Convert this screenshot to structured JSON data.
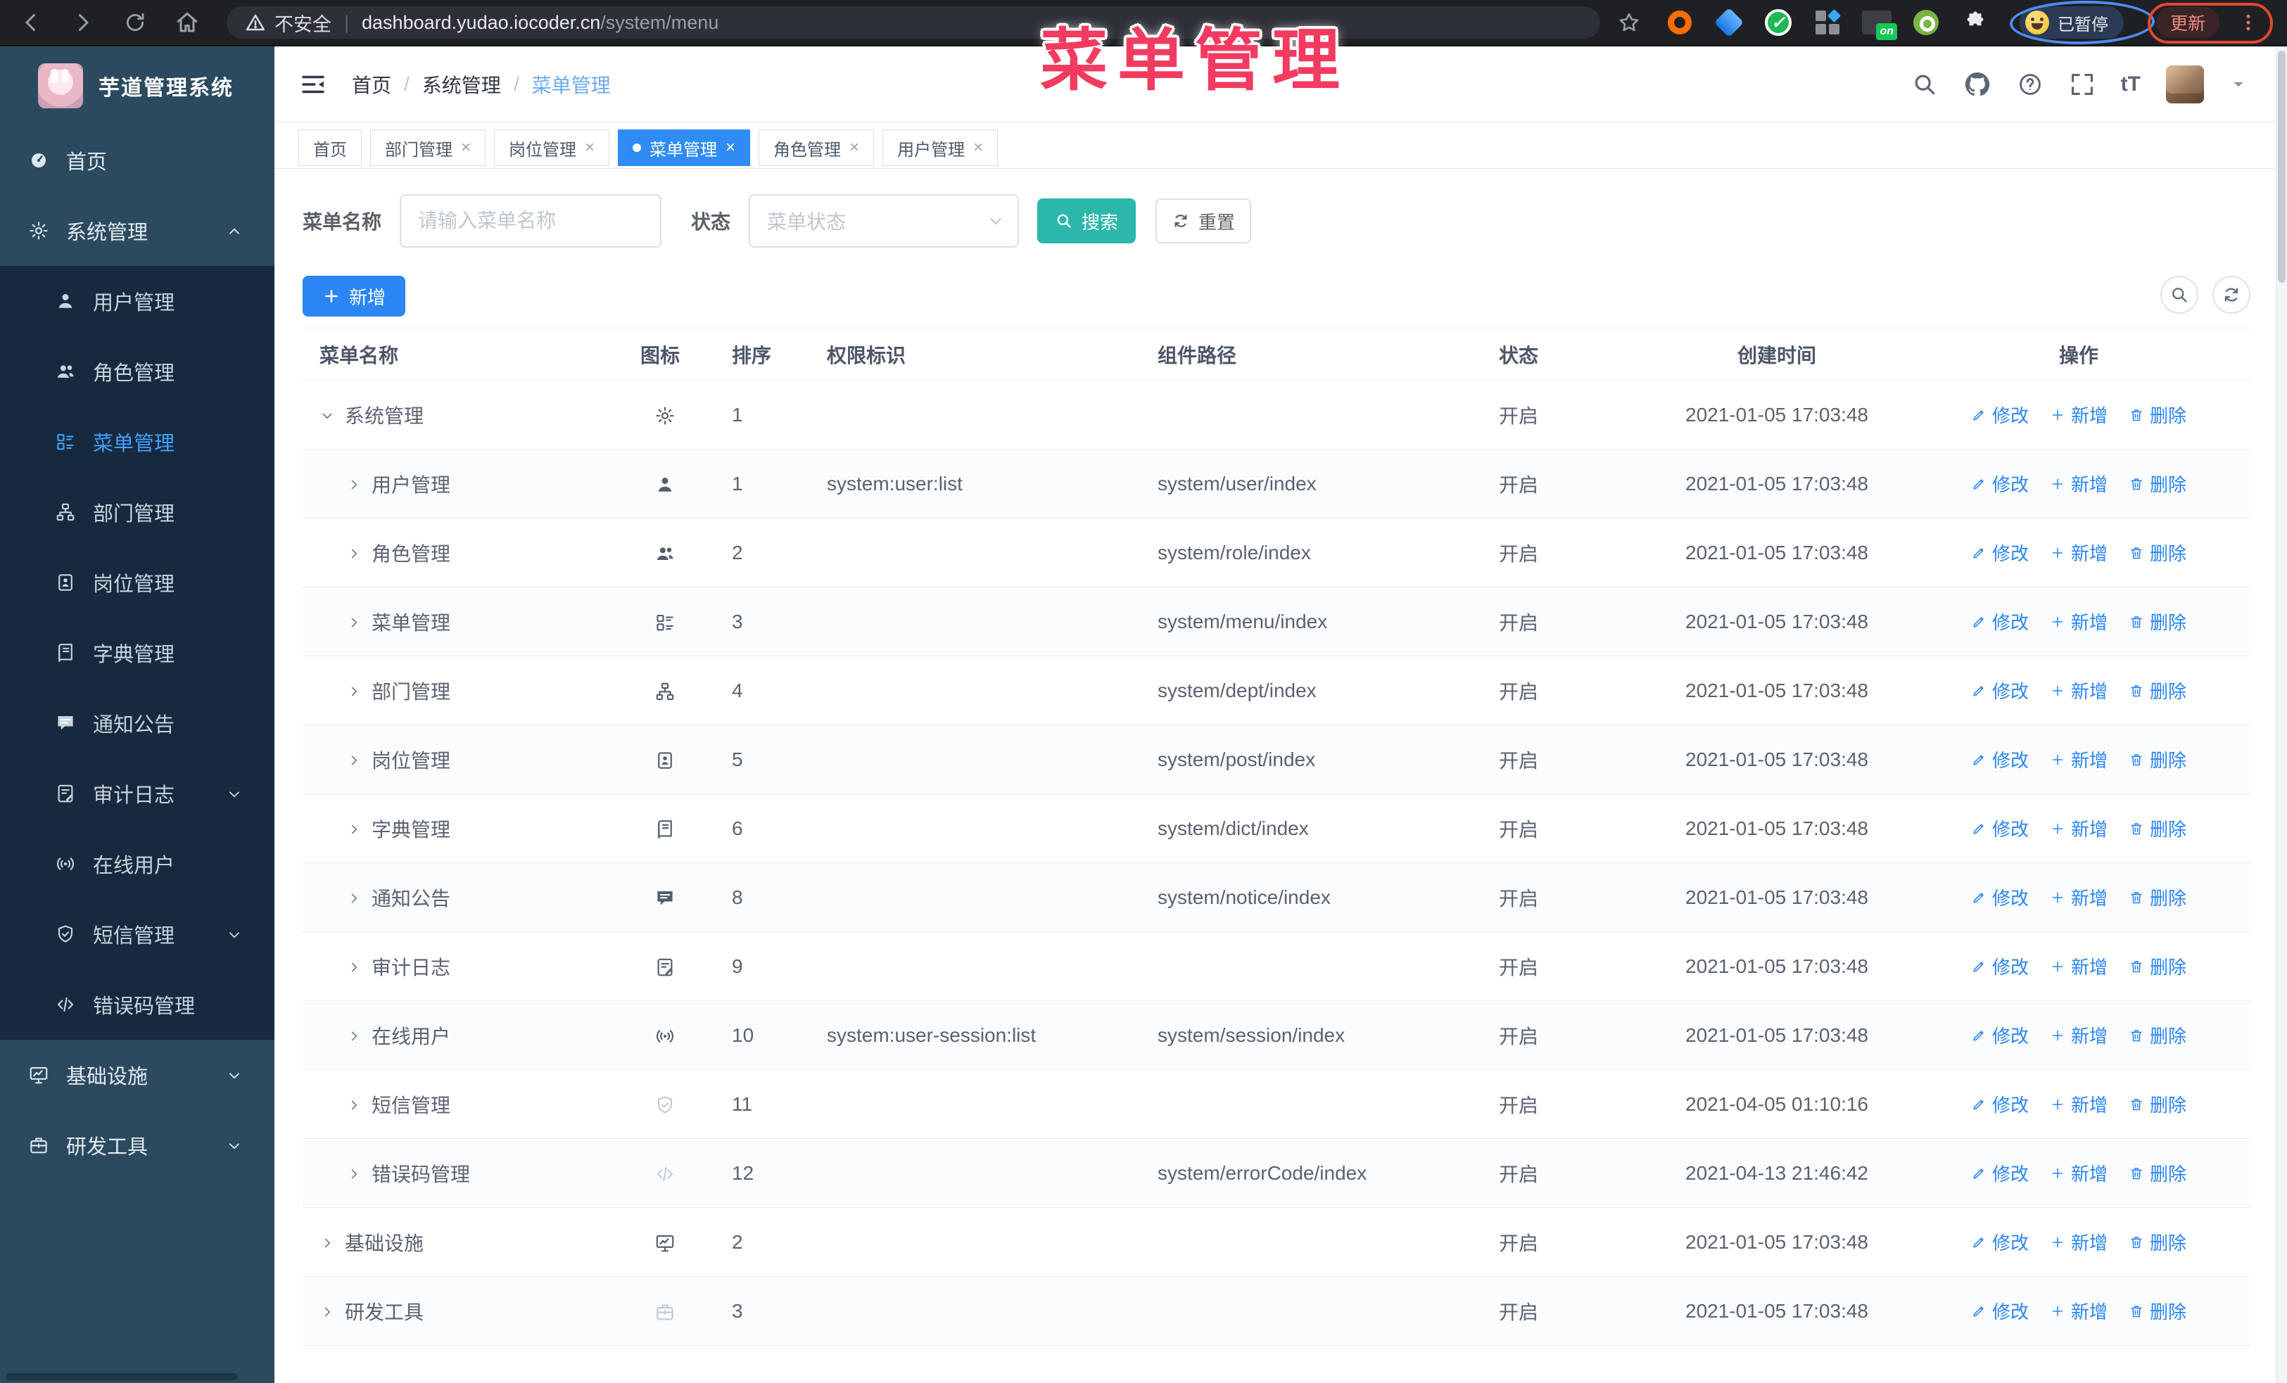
{
  "browser": {
    "security_label": "不安全",
    "url_host": "dashboard.yudao.iocoder.cn",
    "url_path": "/system/menu",
    "paused_badge": "已暂停",
    "update_button": "更新",
    "ext_on_label": "on"
  },
  "annotation": {
    "title": "菜单管理",
    "pink": "#f23b60",
    "blue_ring": "#4f8cf5",
    "red_ring": "#e2472e"
  },
  "sidebar": {
    "app_title": "芋道管理系统",
    "items": [
      {
        "icon": "gauge",
        "label": "首页",
        "type": "root"
      },
      {
        "icon": "gear",
        "label": "系统管理",
        "type": "root",
        "caret": "up",
        "open": true
      },
      {
        "icon": "user",
        "label": "用户管理",
        "type": "sub"
      },
      {
        "icon": "users",
        "label": "角色管理",
        "type": "sub"
      },
      {
        "icon": "menu-tree",
        "label": "菜单管理",
        "type": "sub",
        "active": true
      },
      {
        "icon": "org",
        "label": "部门管理",
        "type": "sub"
      },
      {
        "icon": "badge",
        "label": "岗位管理",
        "type": "sub"
      },
      {
        "icon": "book",
        "label": "字典管理",
        "type": "sub"
      },
      {
        "icon": "notice",
        "label": "通知公告",
        "type": "sub"
      },
      {
        "icon": "log",
        "label": "审计日志",
        "type": "sub",
        "caret": "down"
      },
      {
        "icon": "online",
        "label": "在线用户",
        "type": "sub"
      },
      {
        "icon": "shield",
        "label": "短信管理",
        "type": "sub",
        "caret": "down"
      },
      {
        "icon": "code",
        "label": "错误码管理",
        "type": "sub"
      },
      {
        "icon": "monitor",
        "label": "基础设施",
        "type": "root",
        "caret": "down"
      },
      {
        "icon": "tool",
        "label": "研发工具",
        "type": "root",
        "caret": "down"
      }
    ]
  },
  "navbar": {
    "breadcrumb": [
      "首页",
      "系统管理",
      "菜单管理"
    ]
  },
  "tabs": [
    {
      "label": "首页",
      "closable": false,
      "active": false
    },
    {
      "label": "部门管理",
      "closable": true,
      "active": false
    },
    {
      "label": "岗位管理",
      "closable": true,
      "active": false
    },
    {
      "label": "菜单管理",
      "closable": true,
      "active": true
    },
    {
      "label": "角色管理",
      "closable": true,
      "active": false
    },
    {
      "label": "用户管理",
      "closable": true,
      "active": false
    }
  ],
  "filters": {
    "name_label": "菜单名称",
    "name_placeholder": "请输入菜单名称",
    "status_label": "状态",
    "status_placeholder": "菜单状态",
    "search_label": "搜索",
    "reset_label": "重置"
  },
  "toolbar": {
    "add_label": "新增"
  },
  "table": {
    "columns": [
      "菜单名称",
      "图标",
      "排序",
      "权限标识",
      "组件路径",
      "状态",
      "创建时间",
      "操作"
    ],
    "row_actions": [
      {
        "label": "修改",
        "icon": "edit"
      },
      {
        "label": "新增",
        "icon": "plus"
      },
      {
        "label": "删除",
        "icon": "trash"
      }
    ],
    "rows": [
      {
        "level": 0,
        "expanded": true,
        "name": "系统管理",
        "icon": "gear",
        "sort": "1",
        "perm": "",
        "path": "",
        "status": "开启",
        "time": "2021-01-05 17:03:48"
      },
      {
        "level": 1,
        "expanded": false,
        "name": "用户管理",
        "icon": "user",
        "sort": "1",
        "perm": "system:user:list",
        "path": "system/user/index",
        "status": "开启",
        "time": "2021-01-05 17:03:48"
      },
      {
        "level": 1,
        "expanded": false,
        "name": "角色管理",
        "icon": "users",
        "sort": "2",
        "perm": "",
        "path": "system/role/index",
        "status": "开启",
        "time": "2021-01-05 17:03:48"
      },
      {
        "level": 1,
        "expanded": false,
        "name": "菜单管理",
        "icon": "menu-tree",
        "sort": "3",
        "perm": "",
        "path": "system/menu/index",
        "status": "开启",
        "time": "2021-01-05 17:03:48"
      },
      {
        "level": 1,
        "expanded": false,
        "name": "部门管理",
        "icon": "org",
        "sort": "4",
        "perm": "",
        "path": "system/dept/index",
        "status": "开启",
        "time": "2021-01-05 17:03:48"
      },
      {
        "level": 1,
        "expanded": false,
        "name": "岗位管理",
        "icon": "badge",
        "sort": "5",
        "perm": "",
        "path": "system/post/index",
        "status": "开启",
        "time": "2021-01-05 17:03:48"
      },
      {
        "level": 1,
        "expanded": false,
        "name": "字典管理",
        "icon": "book",
        "sort": "6",
        "perm": "",
        "path": "system/dict/index",
        "status": "开启",
        "time": "2021-01-05 17:03:48"
      },
      {
        "level": 1,
        "expanded": false,
        "name": "通知公告",
        "icon": "notice",
        "sort": "8",
        "perm": "",
        "path": "system/notice/index",
        "status": "开启",
        "time": "2021-01-05 17:03:48"
      },
      {
        "level": 1,
        "expanded": false,
        "name": "审计日志",
        "icon": "log",
        "sort": "9",
        "perm": "",
        "path": "",
        "status": "开启",
        "time": "2021-01-05 17:03:48"
      },
      {
        "level": 1,
        "expanded": false,
        "name": "在线用户",
        "icon": "online",
        "sort": "10",
        "perm": "system:user-session:list",
        "path": "system/session/index",
        "status": "开启",
        "time": "2021-01-05 17:03:48"
      },
      {
        "level": 1,
        "expanded": false,
        "name": "短信管理",
        "icon": "shield",
        "sort": "11",
        "perm": "",
        "path": "",
        "status": "开启",
        "time": "2021-04-05 01:10:16",
        "light_icon": true
      },
      {
        "level": 1,
        "expanded": false,
        "name": "错误码管理",
        "icon": "code",
        "sort": "12",
        "perm": "",
        "path": "system/errorCode/index",
        "status": "开启",
        "time": "2021-04-13 21:46:42",
        "light_icon": true
      },
      {
        "level": 0,
        "expanded": false,
        "name": "基础设施",
        "icon": "monitor",
        "sort": "2",
        "perm": "",
        "path": "",
        "status": "开启",
        "time": "2021-01-05 17:03:48"
      },
      {
        "level": 0,
        "expanded": false,
        "name": "研发工具",
        "icon": "tool",
        "sort": "3",
        "perm": "",
        "path": "",
        "status": "开启",
        "time": "2021-01-05 17:03:48",
        "light_icon": true
      }
    ]
  }
}
